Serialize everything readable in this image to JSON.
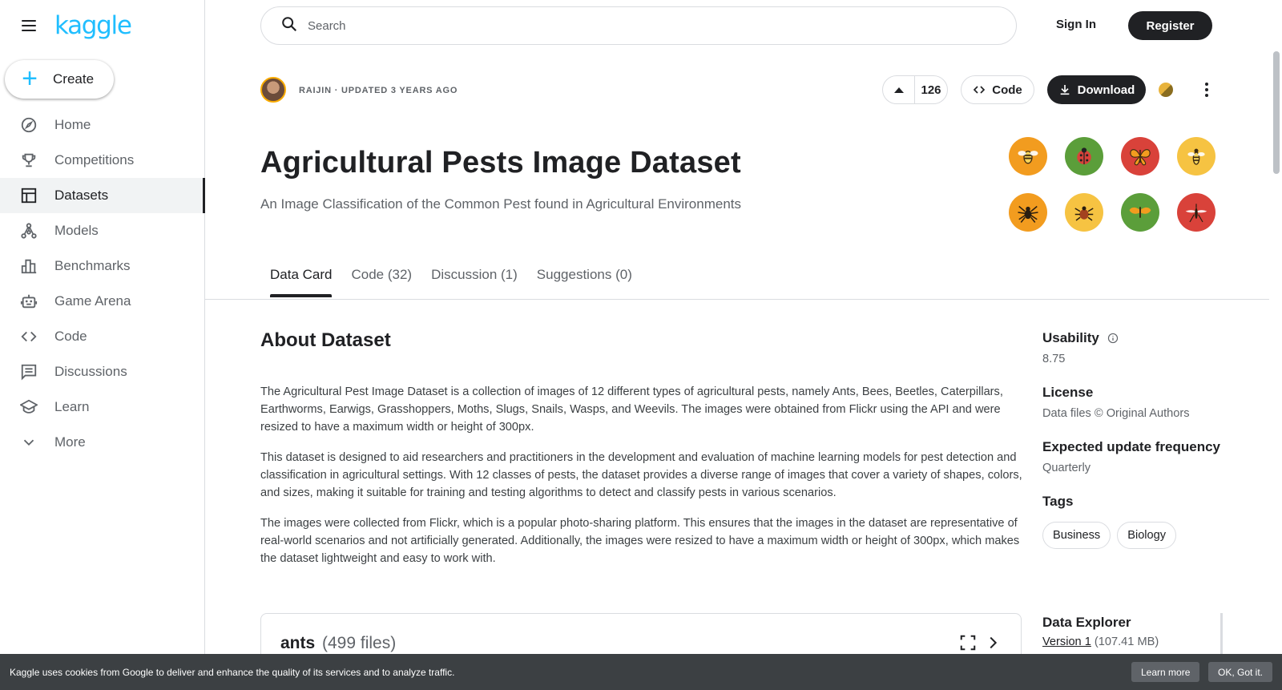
{
  "brand": {
    "logo_text": "kaggle"
  },
  "sidebar": {
    "create_label": "Create",
    "items": [
      {
        "label": "Home",
        "icon": "compass-icon"
      },
      {
        "label": "Competitions",
        "icon": "trophy-icon"
      },
      {
        "label": "Datasets",
        "icon": "table-icon",
        "active": true
      },
      {
        "label": "Models",
        "icon": "models-icon"
      },
      {
        "label": "Benchmarks",
        "icon": "benchmarks-icon"
      },
      {
        "label": "Game Arena",
        "icon": "robot-icon"
      },
      {
        "label": "Code",
        "icon": "code-icon"
      },
      {
        "label": "Discussions",
        "icon": "discussions-icon"
      },
      {
        "label": "Learn",
        "icon": "school-icon"
      },
      {
        "label": "More",
        "icon": "chevron-down-icon"
      }
    ]
  },
  "topbar": {
    "search_placeholder": "Search",
    "signin_label": "Sign In",
    "register_label": "Register"
  },
  "dataset": {
    "meta": "RAIJIN · UPDATED 3 YEARS AGO",
    "vote_count": "126",
    "code_label": "Code",
    "download_label": "Download",
    "title": "Agricultural Pests Image Dataset",
    "subtitle": "An Image Classification of the Common Pest found in Agricultural Environments",
    "pests": [
      {
        "icon": "bee-icon",
        "color": "#f29c1f"
      },
      {
        "icon": "ladybug-icon",
        "color": "#5b9e3a"
      },
      {
        "icon": "butterfly-icon",
        "color": "#d9423a"
      },
      {
        "icon": "wasp-icon",
        "color": "#f6c342"
      },
      {
        "icon": "spider-icon",
        "color": "#f29c1f"
      },
      {
        "icon": "tick-icon",
        "color": "#f6c342"
      },
      {
        "icon": "moth-icon",
        "color": "#5b9e3a"
      },
      {
        "icon": "mosquito-icon",
        "color": "#d9423a"
      }
    ]
  },
  "tabs": [
    {
      "label": "Data Card",
      "active": true
    },
    {
      "label": "Code (32)"
    },
    {
      "label": "Discussion (1)"
    },
    {
      "label": "Suggestions (0)"
    }
  ],
  "about": {
    "heading": "About Dataset",
    "paragraphs": [
      "The Agricultural Pest Image Dataset is a collection of images of 12 different types of agricultural pests, namely Ants, Bees, Beetles, Caterpillars, Earthworms, Earwigs, Grasshoppers, Moths, Slugs, Snails, Wasps, and Weevils. The images were obtained from Flickr using the API and were resized to have a maximum width or height of 300px.",
      "This dataset is designed to aid researchers and practitioners in the development and evaluation of machine learning models for pest detection and classification in agricultural settings. With 12 classes of pests, the dataset provides a diverse range of images that cover a variety of shapes, colors, and sizes, making it suitable for training and testing algorithms to detect and classify pests in various scenarios.",
      "The images were collected from Flickr, which is a popular photo-sharing platform. This ensures that the images in the dataset are representative of real-world scenarios and not artificially generated. Additionally, the images were resized to have a maximum width or height of 300px, which makes the dataset lightweight and easy to work with."
    ]
  },
  "files": {
    "name": "ants",
    "count": "(499 files)"
  },
  "side": {
    "usability_label": "Usability",
    "usability_value": "8.75",
    "license_label": "License",
    "license_value": "Data files © Original Authors",
    "freq_label": "Expected update frequency",
    "freq_value": "Quarterly",
    "tags_label": "Tags",
    "tags": [
      "Business",
      "Biology"
    ],
    "explorer_label": "Data Explorer",
    "version_link": "Version 1",
    "version_size": "(107.41 MB)"
  },
  "cookie": {
    "message": "Kaggle uses cookies from Google to deliver and enhance the quality of its services and to analyze traffic.",
    "learn_label": "Learn more",
    "ok_label": "OK, Got it."
  }
}
